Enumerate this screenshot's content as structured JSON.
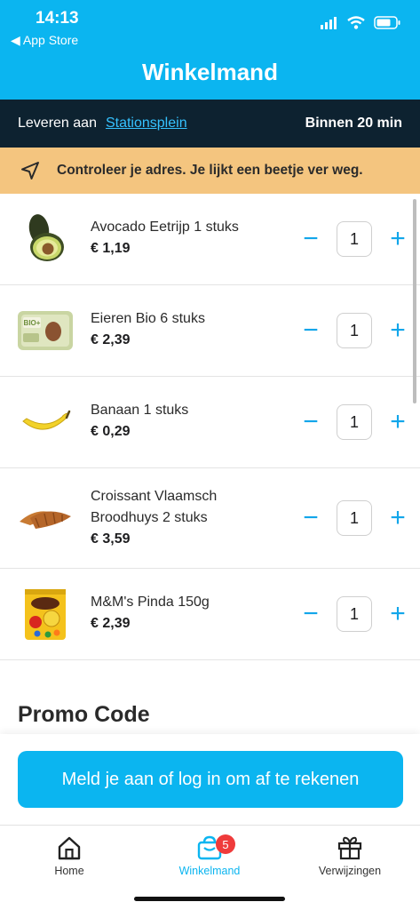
{
  "status_bar": {
    "time": "14:13",
    "back_label": "App Store"
  },
  "header": {
    "title": "Winkelmand"
  },
  "delivery": {
    "label": "Leveren aan",
    "address": "Stationsplein",
    "eta": "Binnen 20 min"
  },
  "warning": {
    "text": "Controleer je adres. Je lijkt een beetje ver weg."
  },
  "cart": {
    "items": [
      {
        "name_line1": "Avocado Eetrijp 1 stuks",
        "name_line2": "",
        "price": "€ 1,19",
        "qty": "1",
        "image": "avocado"
      },
      {
        "name_line1": "Eieren Bio 6 stuks",
        "name_line2": "",
        "price": "€ 2,39",
        "qty": "1",
        "image": "egg-box"
      },
      {
        "name_line1": "Banaan 1 stuks",
        "name_line2": "",
        "price": "€ 0,29",
        "qty": "1",
        "image": "banana"
      },
      {
        "name_line1": "Croissant Vlaamsch",
        "name_line2": "Broodhuys 2 stuks",
        "price": "€ 3,59",
        "qty": "1",
        "image": "croissant"
      },
      {
        "name_line1": "M&M's Pinda 150g",
        "name_line2": "",
        "price": "€ 2,39",
        "qty": "1",
        "image": "mms-bag"
      }
    ],
    "minus_symbol": "−",
    "plus_symbol": "+"
  },
  "promo": {
    "title": "Promo Code"
  },
  "checkout": {
    "button_label": "Meld je aan of log in om af te rekenen"
  },
  "tabbar": {
    "tabs": [
      {
        "label": "Home",
        "icon": "house-icon"
      },
      {
        "label": "Winkelmand",
        "icon": "basket-icon",
        "badge": "5"
      },
      {
        "label": "Verwijzingen",
        "icon": "gift-icon"
      }
    ]
  },
  "colors": {
    "brand": "#0bb5f0",
    "dark_bar": "#0d2230",
    "warning": "#f4c57f",
    "badge": "#ef3b3b"
  }
}
